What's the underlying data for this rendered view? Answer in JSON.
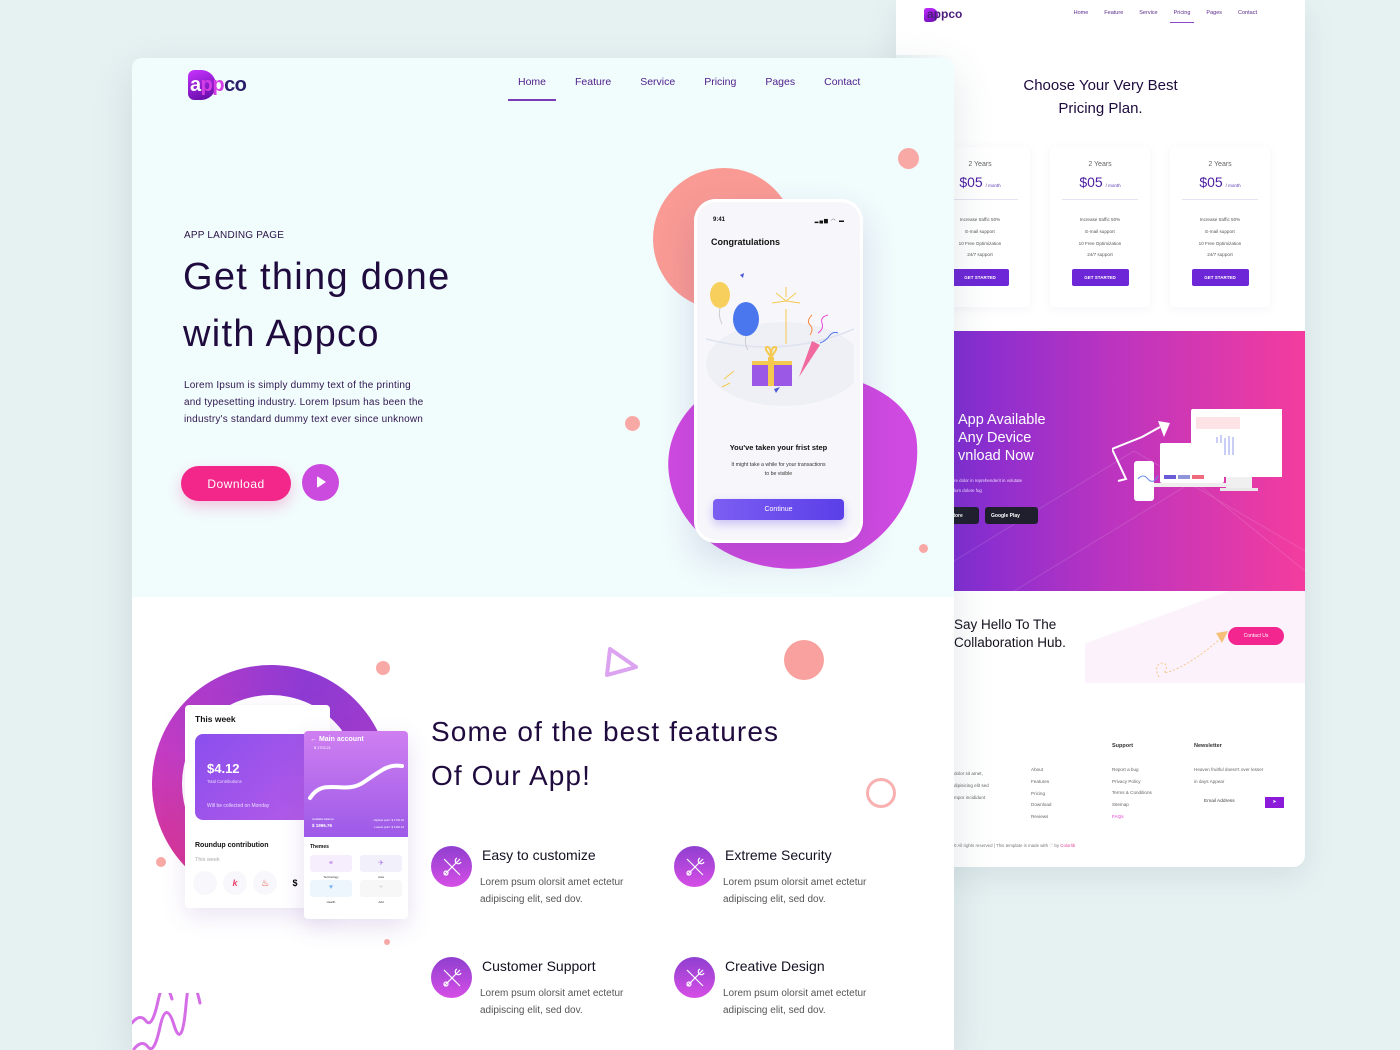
{
  "front": {
    "logo": {
      "a": "a",
      "pp": "pp",
      "co": "co"
    },
    "nav": [
      {
        "label": "Home",
        "active": true
      },
      {
        "label": "Feature"
      },
      {
        "label": "Service"
      },
      {
        "label": "Pricing"
      },
      {
        "label": "Pages"
      },
      {
        "label": "Contact"
      }
    ],
    "hero": {
      "eyebrow": "APP LANDING PAGE",
      "title": "Get thing done\nwith Appco",
      "description": "Lorem Ipsum is simply dummy text of the printing\nand typesetting industry. Lorem Ipsum has been the\nindustry's standard dummy text ever since unknown",
      "download_label": "Download",
      "play_icon": "play-icon"
    },
    "phone": {
      "time": "9:41",
      "status": "▂▄▆ ◠ ▬",
      "title": "Congratulations",
      "message": "You've taken your frist step",
      "sub": "It might take a while for your transactions\nto be visible",
      "button": "Continue"
    },
    "features_section": {
      "title": "Some of the best features\nOf Our App!",
      "items": [
        {
          "title": "Easy to customize",
          "desc": "Lorem psum olorsit amet ectetur\nadipiscing elit, sed dov.",
          "icon": "tools-icon"
        },
        {
          "title": "Extreme Security",
          "desc": "Lorem psum olorsit amet ectetur\nadipiscing elit, sed dov.",
          "icon": "tools-icon"
        },
        {
          "title": "Customer Support",
          "desc": "Lorem psum olorsit amet ectetur\nadipiscing elit, sed dov.",
          "icon": "tools-icon"
        },
        {
          "title": "Creative Design",
          "desc": "Lorem psum olorsit amet ectetur\nadipiscing elit, sed dov.",
          "icon": "tools-icon"
        }
      ]
    },
    "mock_week": {
      "title": "This week",
      "amount": "$4.12",
      "amount_label": "Total Contributions",
      "collected": "Will be collected on Monday",
      "roundup_title": "Roundup contribution",
      "roundup_sub": "This week",
      "peek": "$"
    },
    "mock_account": {
      "title": "← Main account",
      "sub": "$ 1703.21",
      "available_label": "Available balance",
      "available_value": "$ 1996.76",
      "high_low": "Highest point  $ 1732.32\nLowest point  $ 1462.16",
      "themes_title": "Themes",
      "themes": [
        {
          "label": "Technology",
          "glyph": "⚭"
        },
        {
          "label": "Asia",
          "glyph": "✈"
        },
        {
          "label": "Health",
          "glyph": "♥"
        },
        {
          "label": "Add",
          "glyph": "+"
        }
      ]
    }
  },
  "back": {
    "nav": [
      {
        "label": "Home"
      },
      {
        "label": "Feature"
      },
      {
        "label": "Service"
      },
      {
        "label": "Pricing",
        "active": true
      },
      {
        "label": "Pages"
      },
      {
        "label": "Contact"
      }
    ],
    "logo": "appco",
    "pricing_title": "Choose Your Very Best\nPricing Plan.",
    "plans": [
      {
        "term": "2 Years",
        "price": "$05",
        "per": "/ month",
        "features": [
          "Increase traffic 50%",
          "E-mail support",
          "10 Free Optimization",
          "24/7 support"
        ],
        "cta": "GET STARTED"
      },
      {
        "term": "2 Years",
        "price": "$05",
        "per": "/ month",
        "features": [
          "Increase traffic 50%",
          "E-mail support",
          "10 Free Optimization",
          "24/7 support"
        ],
        "cta": "GET STARTED"
      },
      {
        "term": "2 Years",
        "price": "$05",
        "per": "/ month",
        "features": [
          "Increase traffic 50%",
          "E-mail support",
          "10 Free Optimization",
          "24/7 support"
        ],
        "cta": "GET STARTED"
      }
    ],
    "app_section": {
      "title": "App Available\nAny Device\nvnload Now",
      "desc": "re dolor in reprehenderit in volutate\nlum dolore fug",
      "app_store": "Store",
      "google_play": "Google Play"
    },
    "contact_section": {
      "title": "Say Hello To The\nCollaboration Hub.",
      "button": "Contact Us"
    },
    "footer": {
      "about_text": "dolor sit amet,\ndipisicing elit sed\nmpor incididunt",
      "links": [
        "About",
        "Features",
        "Pricing",
        "Download",
        "Reviews"
      ],
      "support_head": "Support",
      "support": [
        "Report a bug",
        "Privacy Policy",
        "Terms & Conditions",
        "Sitemap"
      ],
      "faq": "FAQs",
      "newsletter_head": "Newsletter",
      "newsletter_text": "Heaven fruitful doesn't over lesser\nin days Appear",
      "email_placeholder": "Email Address",
      "copyright": "0 All rights reserved | This template is made with ♡ by ",
      "credit": "Colorlib"
    }
  }
}
